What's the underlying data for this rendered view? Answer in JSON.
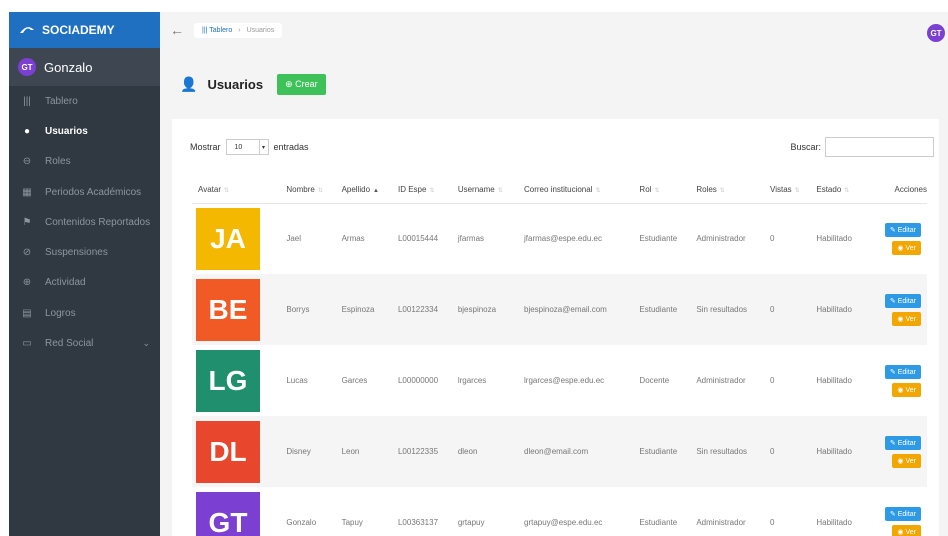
{
  "brand": {
    "name": "SOCIADEMY"
  },
  "profile": {
    "initials": "GT",
    "name": "Gonzalo"
  },
  "nav": [
    {
      "icon": "bars-icon",
      "glyph": "|||",
      "label": "Tablero"
    },
    {
      "icon": "user-icon",
      "glyph": "●",
      "label": "Usuarios"
    },
    {
      "icon": "lock-icon",
      "glyph": "⊖",
      "label": "Roles"
    },
    {
      "icon": "calendar-icon",
      "glyph": "▦",
      "label": "Periodos Académicos"
    },
    {
      "icon": "report-icon",
      "glyph": "⚑",
      "label": "Contenidos Reportados"
    },
    {
      "icon": "ban-icon",
      "glyph": "⊘",
      "label": "Suspensiones"
    },
    {
      "icon": "activity-icon",
      "glyph": "⊕",
      "label": "Actividad"
    },
    {
      "icon": "trophy-icon",
      "glyph": "▤",
      "label": "Logros"
    },
    {
      "icon": "network-icon",
      "glyph": "▭",
      "label": "Red Social"
    }
  ],
  "breadcrumb": {
    "root": "Tablero",
    "current": "Usuarios"
  },
  "page": {
    "title": "Usuarios",
    "create_label": "Crear"
  },
  "controls": {
    "show_label": "Mostrar",
    "page_size": "10",
    "entries_label": "entradas",
    "search_label": "Buscar:"
  },
  "table": {
    "headers": [
      "Avatar",
      "Nombre",
      "Apellido",
      "ID Espe",
      "Username",
      "Correo institucional",
      "Rol",
      "Roles",
      "Vistas",
      "Estado",
      "Acciones"
    ],
    "rows": [
      {
        "initials": "JA",
        "color": "#f5b800",
        "nombre": "Jael",
        "apellido": "Armas",
        "id": "L00015444",
        "username": "jfarmas",
        "correo": "jfarmas@espe.edu.ec",
        "rol": "Estudiante",
        "roles": "Administrador",
        "vistas": "0",
        "estado": "Habilitado"
      },
      {
        "initials": "BE",
        "color": "#f15a24",
        "nombre": "Borrys",
        "apellido": "Espinoza",
        "id": "L00122334",
        "username": "bjespinoza",
        "correo": "bjespinoza@email.com",
        "rol": "Estudiante",
        "roles": "Sin resultados",
        "vistas": "0",
        "estado": "Habilitado"
      },
      {
        "initials": "LG",
        "color": "#1f8f6e",
        "nombre": "Lucas",
        "apellido": "Garces",
        "id": "L00000000",
        "username": "lrgarces",
        "correo": "lrgarces@espe.edu.ec",
        "rol": "Docente",
        "roles": "Administrador",
        "vistas": "0",
        "estado": "Habilitado"
      },
      {
        "initials": "DL",
        "color": "#e8472e",
        "nombre": "Disney",
        "apellido": "Leon",
        "id": "L00122335",
        "username": "dleon",
        "correo": "dleon@email.com",
        "rol": "Estudiante",
        "roles": "Sin resultados",
        "vistas": "0",
        "estado": "Habilitado"
      },
      {
        "initials": "GT",
        "color": "#7b3fd1",
        "nombre": "Gonzalo",
        "apellido": "Tapuy",
        "id": "L00363137",
        "username": "grtapuy",
        "correo": "grtapuy@espe.edu.ec",
        "rol": "Estudiante",
        "roles": "Administrador",
        "vistas": "0",
        "estado": "Habilitado"
      }
    ],
    "edit_label": "Editar",
    "view_label": "Ver"
  }
}
